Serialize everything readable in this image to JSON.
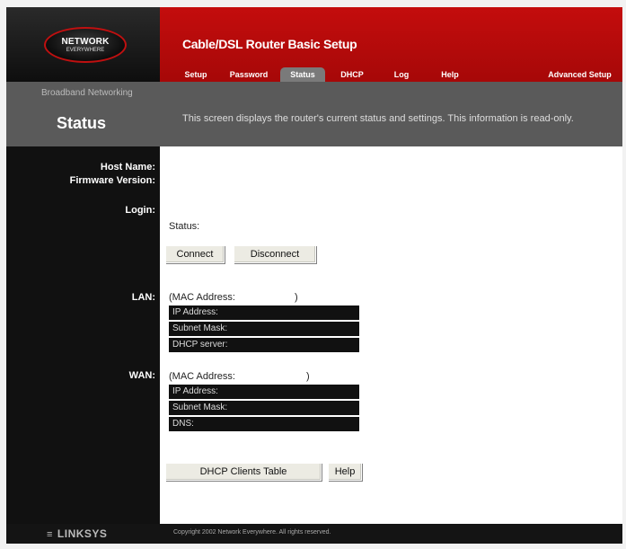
{
  "logo": {
    "line1": "NETWORK",
    "line2": "EVERYWHERE"
  },
  "header": {
    "title": "Cable/DSL Router Basic Setup"
  },
  "nav": {
    "tabs": [
      {
        "label": "Setup"
      },
      {
        "label": "Password"
      },
      {
        "label": "Status",
        "active": true
      },
      {
        "label": "DHCP"
      },
      {
        "label": "Log"
      },
      {
        "label": "Help"
      }
    ],
    "advanced": "Advanced Setup"
  },
  "section": {
    "label": "Broadband Networking",
    "heading": "Status",
    "description": "This screen displays the router's current status and settings. This information is read-only."
  },
  "labels": {
    "host_name": "Host Name:",
    "firmware_version": "Firmware Version:",
    "login": "Login:",
    "lan": "LAN:",
    "wan": "WAN:"
  },
  "login": {
    "status_label": "Status:",
    "connect": "Connect",
    "disconnect": "Disconnect"
  },
  "lan": {
    "mac": "(MAC Address:",
    "mac_close": ")",
    "rows": [
      "IP Address:",
      "Subnet Mask:",
      "DHCP server:"
    ]
  },
  "wan": {
    "mac": "(MAC Address:",
    "mac_close": ")",
    "rows": [
      "IP Address:",
      "Subnet Mask:",
      "DNS:"
    ]
  },
  "buttons": {
    "dhcp_clients": "DHCP Clients Table",
    "help": "Help"
  },
  "footer": {
    "brand": "LINKSYS",
    "brand_mark": "≡",
    "copyright": "Copyright 2002 Network Everywhere. All rights reserved."
  },
  "colors": {
    "header_red": "#c40d0d",
    "band_gray": "#5a5a5a",
    "frame_black": "#111111"
  }
}
